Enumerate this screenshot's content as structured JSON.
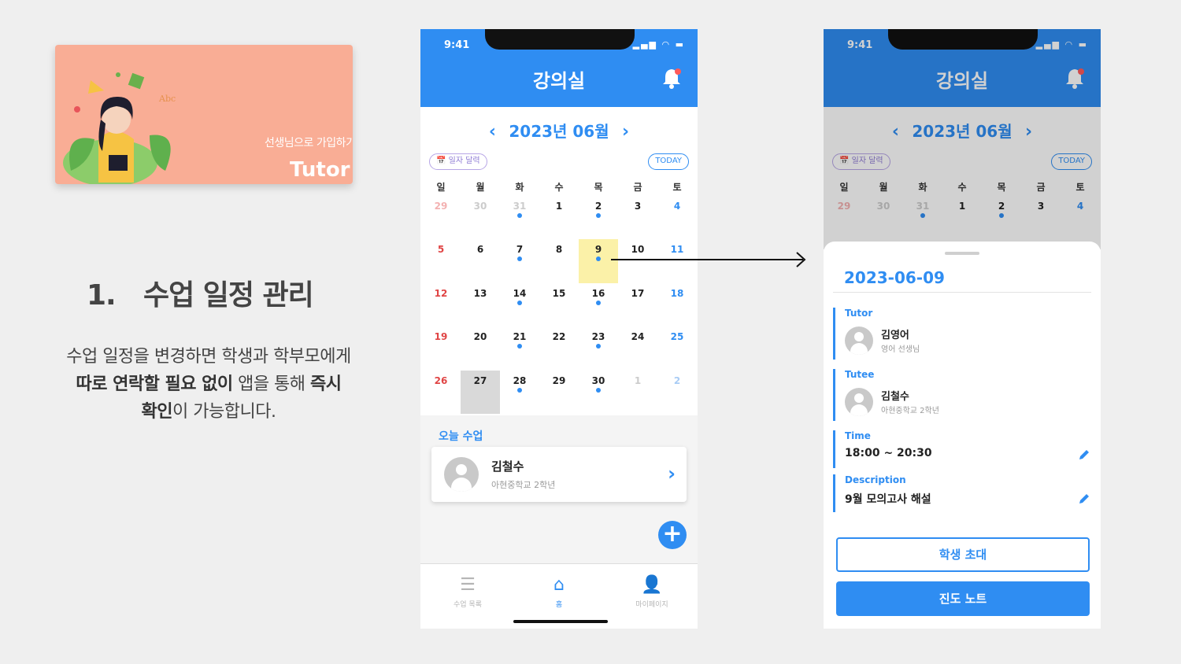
{
  "card": {
    "subtitle": "선생님으로 가입하기",
    "title": "Tutor"
  },
  "section": {
    "number": "1.",
    "title": "수업 일정 관리"
  },
  "description": {
    "line1": "수업 일정을 변경하면 학생과 학부모에게",
    "bold1": "따로 연락할 필요 없이",
    "plain2": " 앱을 통해 ",
    "bold2": "즉시",
    "bold3": "확인",
    "plain3": "이 가능합니다."
  },
  "status": {
    "time": "9:41",
    "icons": "▂▄▆ ◠ ▬"
  },
  "app": {
    "title": "강의실"
  },
  "calendar": {
    "month": "2023년 06월",
    "prev": "‹",
    "next": "›",
    "picker_label": "📅 일자 달력",
    "today_label": "TODAY",
    "weekdays": [
      "일",
      "월",
      "화",
      "수",
      "목",
      "금",
      "토"
    ],
    "weeks": [
      [
        {
          "d": "29",
          "m": true
        },
        {
          "d": "30",
          "m": true
        },
        {
          "d": "31",
          "m": true,
          "dot": true
        },
        {
          "d": "1"
        },
        {
          "d": "2",
          "dot": true
        },
        {
          "d": "3"
        },
        {
          "d": "4"
        }
      ],
      [
        {
          "d": "5"
        },
        {
          "d": "6"
        },
        {
          "d": "7",
          "dot": true
        },
        {
          "d": "8"
        },
        {
          "d": "9",
          "dot": true,
          "sel": true
        },
        {
          "d": "10"
        },
        {
          "d": "11"
        }
      ],
      [
        {
          "d": "12"
        },
        {
          "d": "13"
        },
        {
          "d": "14",
          "dot": true
        },
        {
          "d": "15"
        },
        {
          "d": "16",
          "dot": true
        },
        {
          "d": "17"
        },
        {
          "d": "18"
        }
      ],
      [
        {
          "d": "19"
        },
        {
          "d": "20"
        },
        {
          "d": "21",
          "dot": true
        },
        {
          "d": "22"
        },
        {
          "d": "23",
          "dot": true
        },
        {
          "d": "24"
        },
        {
          "d": "25"
        }
      ],
      [
        {
          "d": "26"
        },
        {
          "d": "27",
          "today": true
        },
        {
          "d": "28",
          "dot": true
        },
        {
          "d": "29"
        },
        {
          "d": "30",
          "dot": true
        },
        {
          "d": "1",
          "m": true
        },
        {
          "d": "2",
          "m": true
        }
      ]
    ]
  },
  "today_class": {
    "label": "오늘 수업",
    "name": "김철수",
    "school": "아현중학교 2학년",
    "add": "+"
  },
  "tabs": [
    {
      "label": "수업 목록",
      "icon": "☰"
    },
    {
      "label": "홈",
      "icon": "⌂"
    },
    {
      "label": "마이페이지",
      "icon": "👤"
    }
  ],
  "detail": {
    "date": "2023-06-09",
    "tutor_label": "Tutor",
    "tutor_name": "김영어",
    "tutor_sub": "영어 선생님",
    "tutee_label": "Tutee",
    "tutee_name": "김철수",
    "tutee_sub": "아현중학교 2학년",
    "time_label": "Time",
    "time_value": "18:00 ~ 20:30",
    "desc_label": "Description",
    "desc_value": "9월 모의고사 해설",
    "invite_button": "학생 초대",
    "progress_button": "진도 노트"
  },
  "colors": {
    "accent": "#2f8df2",
    "card": "#f9ad95",
    "highlight": "#fbf1a8"
  }
}
